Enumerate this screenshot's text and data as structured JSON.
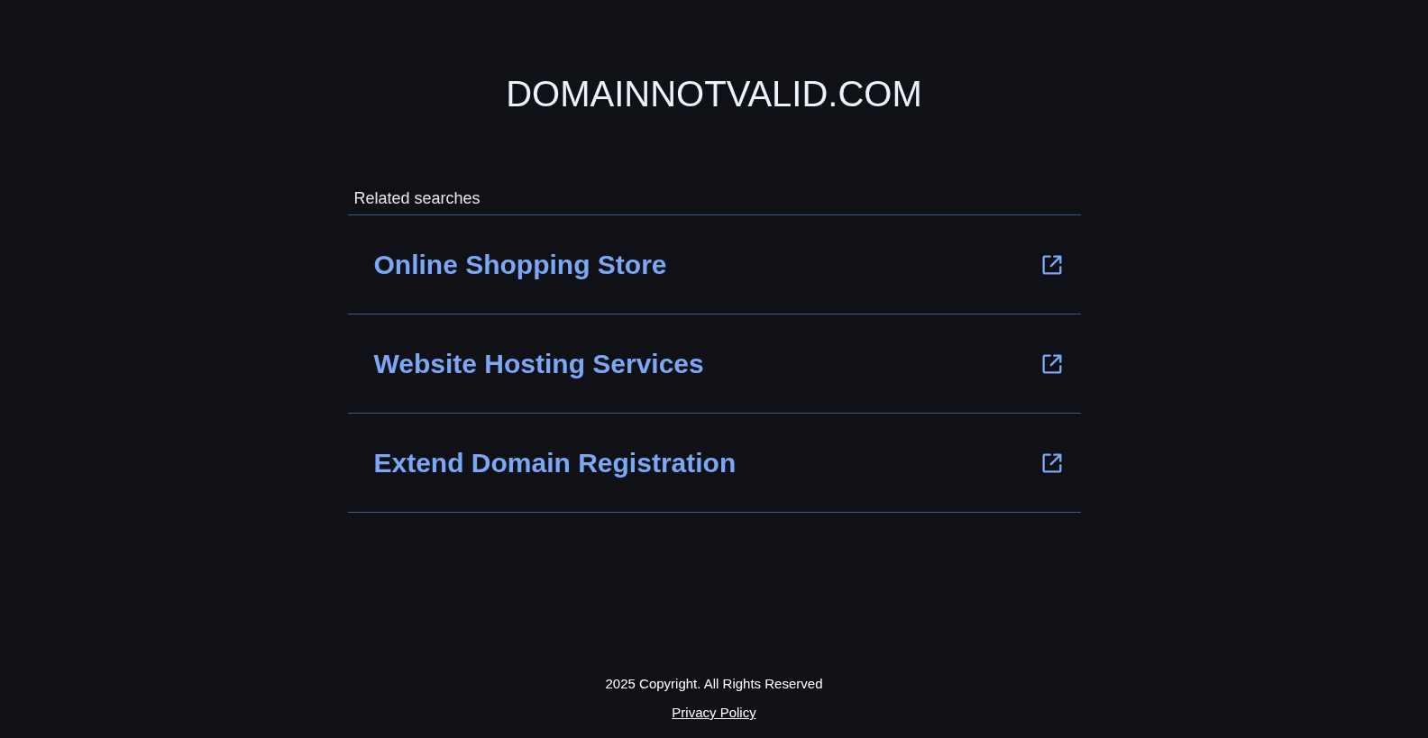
{
  "header": {
    "title": "DOMAINNOTVALID.COM"
  },
  "related": {
    "heading": "Related searches",
    "items": [
      {
        "label": "Online Shopping Store"
      },
      {
        "label": "Website Hosting Services"
      },
      {
        "label": "Extend Domain Registration"
      }
    ]
  },
  "footer": {
    "copyright": "2025 Copyright. All Rights Reserved",
    "privacy_link": "Privacy Policy"
  }
}
